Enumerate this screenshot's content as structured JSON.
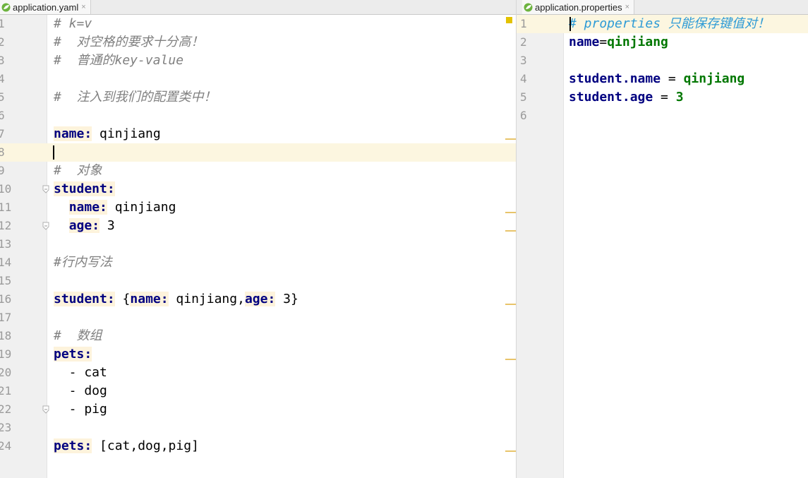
{
  "left_tab": {
    "label": "application.yaml",
    "close": "×"
  },
  "right_tab": {
    "label": "application.properties",
    "close": "×"
  },
  "yaml_lines": [
    [
      {
        "t": "# k=v",
        "c": "cmt"
      }
    ],
    [
      {
        "t": "#  对空格的要求十分高！",
        "c": "cmt"
      }
    ],
    [
      {
        "t": "#  普通的key-value",
        "c": "cmt"
      }
    ],
    [],
    [
      {
        "t": "#  注入到我们的配置类中！",
        "c": "cmt"
      }
    ],
    [],
    [
      {
        "t": "name:",
        "c": "key"
      },
      {
        "t": " qinjiang",
        "c": "plain"
      }
    ],
    [],
    [
      {
        "t": "#  对象",
        "c": "cmt"
      }
    ],
    [
      {
        "t": "student:",
        "c": "key"
      }
    ],
    [
      {
        "t": "  ",
        "c": "plain"
      },
      {
        "t": "name:",
        "c": "key"
      },
      {
        "t": " qinjiang",
        "c": "plain"
      }
    ],
    [
      {
        "t": "  ",
        "c": "plain"
      },
      {
        "t": "age:",
        "c": "key"
      },
      {
        "t": " 3",
        "c": "plain"
      }
    ],
    [],
    [
      {
        "t": "#行内写法",
        "c": "cmt"
      }
    ],
    [],
    [
      {
        "t": "student:",
        "c": "key"
      },
      {
        "t": " {",
        "c": "plain"
      },
      {
        "t": "name:",
        "c": "key"
      },
      {
        "t": " qinjiang,",
        "c": "plain"
      },
      {
        "t": "age:",
        "c": "key"
      },
      {
        "t": " 3}",
        "c": "plain"
      }
    ],
    [],
    [
      {
        "t": "#  数组",
        "c": "cmt"
      }
    ],
    [
      {
        "t": "pets:",
        "c": "key"
      }
    ],
    [
      {
        "t": "  - cat",
        "c": "plain"
      }
    ],
    [
      {
        "t": "  - dog",
        "c": "plain"
      }
    ],
    [
      {
        "t": "  - pig",
        "c": "plain"
      }
    ],
    [],
    [
      {
        "t": "pets:",
        "c": "key"
      },
      {
        "t": " [cat,dog,pig]",
        "c": "plain"
      }
    ]
  ],
  "properties_lines": [
    [
      {
        "t": "# properties 只能保存键值对！",
        "c": "pcmt"
      }
    ],
    [
      {
        "t": "name",
        "c": "pkey"
      },
      {
        "t": "=",
        "c": "plain"
      },
      {
        "t": "qinjiang",
        "c": "pval"
      }
    ],
    [],
    [
      {
        "t": "student.name",
        "c": "pkey"
      },
      {
        "t": " = ",
        "c": "plain"
      },
      {
        "t": "qinjiang",
        "c": "pval"
      }
    ],
    [
      {
        "t": "student.age",
        "c": "pkey"
      },
      {
        "t": " = ",
        "c": "plain"
      },
      {
        "t": "3",
        "c": "pval"
      }
    ],
    []
  ],
  "yaml_line_numbers": [
    "1",
    "2",
    "3",
    "4",
    "5",
    "6",
    "7",
    "8",
    "9",
    "10",
    "11",
    "12",
    "13",
    "14",
    "15",
    "16",
    "17",
    "18",
    "19",
    "20",
    "21",
    "22",
    "23",
    "24"
  ],
  "properties_line_numbers": [
    "1",
    "2",
    "3",
    "4",
    "5",
    "6"
  ],
  "current_line": 8,
  "fold_lines": [
    10,
    12,
    22
  ],
  "marker_lines": [
    7,
    11,
    12,
    16,
    19,
    24
  ],
  "icons": {
    "file_icon": "spring-leaf-icon"
  },
  "colors": {
    "key": "#000080",
    "comment": "#808080",
    "properties_value": "#007700",
    "marker": "#e8c46a"
  }
}
